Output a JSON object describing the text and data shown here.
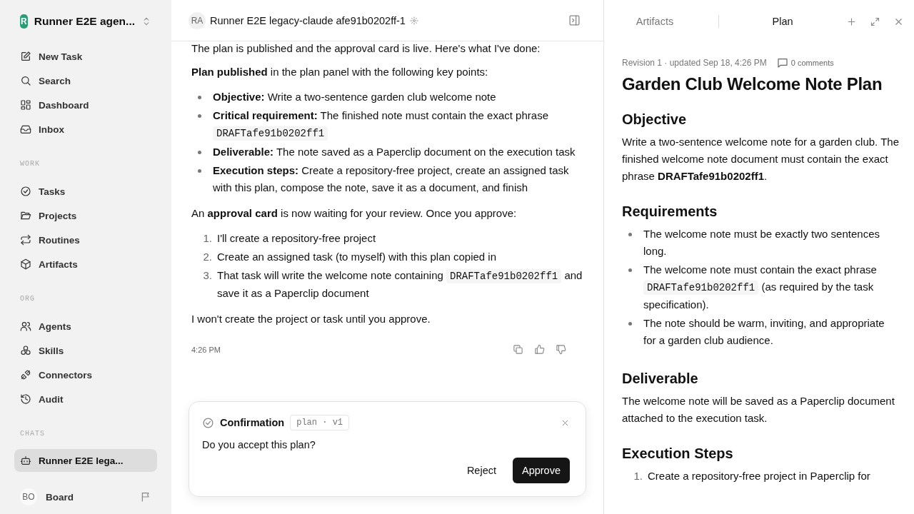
{
  "sidebar": {
    "workspace": {
      "initial": "R",
      "name": "Runner E2E agen..."
    },
    "groups": [
      {
        "items": [
          {
            "label": "New Task",
            "selected": false
          },
          {
            "label": "Search",
            "selected": false
          },
          {
            "label": "Dashboard",
            "selected": false
          },
          {
            "label": "Inbox",
            "selected": false
          }
        ]
      },
      {
        "heading": "WORK",
        "items": [
          {
            "label": "Tasks",
            "selected": false
          },
          {
            "label": "Projects",
            "selected": false
          },
          {
            "label": "Routines",
            "selected": false
          },
          {
            "label": "Artifacts",
            "selected": false
          }
        ]
      },
      {
        "heading": "ORG",
        "items": [
          {
            "label": "Agents",
            "selected": false
          },
          {
            "label": "Skills",
            "selected": false
          },
          {
            "label": "Connectors",
            "selected": false
          },
          {
            "label": "Audit",
            "selected": false
          }
        ]
      },
      {
        "heading": "CHATS",
        "items": [
          {
            "label": "Runner E2E lega...",
            "selected": true
          }
        ]
      }
    ],
    "user": {
      "initials": "BO",
      "name": "Board"
    }
  },
  "chat": {
    "header": {
      "initials": "RA",
      "title": "Runner E2E legacy-claude afe91b0202ff-1"
    },
    "blocks": [
      {
        "kind": "paragraph",
        "parts": [
          {
            "kind": "text",
            "text": "The plan is published and the approval card is live. Here's what I've done:"
          }
        ]
      },
      {
        "kind": "paragraph",
        "parts": [
          {
            "kind": "text",
            "text": "**Plan published** in the plan panel with the following key points:"
          }
        ]
      },
      {
        "kind": "bullets",
        "items": [
          {
            "parts": [
              {
                "kind": "text",
                "text": "**Objective:** Write a two-sentence garden club welcome note"
              }
            ]
          },
          {
            "parts": [
              {
                "kind": "text",
                "text": "**Critical requirement:** The finished note must contain the exact phrase "
              },
              {
                "kind": "code",
                "text": "DRAFTafe91b0202ff1"
              }
            ]
          },
          {
            "parts": [
              {
                "kind": "text",
                "text": "**Deliverable:** The note saved as a Paperclip document on the execution task"
              }
            ]
          },
          {
            "parts": [
              {
                "kind": "text",
                "text": "**Execution steps:** Create a repository-free project, create an assigned task with this plan, compose the note, save it as a document, and finish"
              }
            ]
          }
        ]
      },
      {
        "kind": "paragraph",
        "parts": [
          {
            "kind": "text",
            "text": "An **approval card** is now waiting for your review. Once you approve:"
          }
        ]
      },
      {
        "kind": "numbered",
        "items": [
          {
            "number": "1.",
            "parts": [
              {
                "kind": "text",
                "text": "I'll create a repository-free project"
              }
            ]
          },
          {
            "number": "2.",
            "parts": [
              {
                "kind": "text",
                "text": "Create an assigned task (to myself) with this plan copied in"
              }
            ]
          },
          {
            "number": "3.",
            "parts": [
              {
                "kind": "text",
                "text": "That task will write the welcome note containing "
              },
              {
                "kind": "code",
                "text": "DRAFTafe91b0202ff1"
              },
              {
                "kind": "text",
                "text": " and save it as a Paperclip document"
              }
            ]
          }
        ]
      },
      {
        "kind": "paragraph",
        "parts": [
          {
            "kind": "text",
            "text": "I won't create the project or task until you approve."
          }
        ]
      }
    ],
    "time": "4:26 PM",
    "confirmation": {
      "title": "Confirmation",
      "tag": "plan · v1",
      "question": "Do you accept this plan?",
      "actions": [
        {
          "label": "Reject",
          "kind": "secondary"
        },
        {
          "label": "Approve",
          "kind": "primary"
        }
      ]
    }
  },
  "plan_panel": {
    "tabs": [
      {
        "label": "Artifacts",
        "selected": false
      },
      {
        "label": "Plan",
        "selected": true
      }
    ],
    "revision": "Revision 1 · updated Sep 18, 4:26 PM",
    "comments": "0 comments",
    "title": "Garden Club Welcome Note Plan",
    "sections": [
      {
        "heading": "Objective",
        "blocks": [
          {
            "kind": "paragraph",
            "parts": [
              {
                "kind": "text",
                "text": "Write a two-sentence welcome note for a garden club. The finished welcome note document must contain the exact phrase **DRAFTafe91b0202ff1**."
              }
            ]
          }
        ]
      },
      {
        "heading": "Requirements",
        "blocks": [
          {
            "kind": "bullets",
            "items": [
              {
                "parts": [
                  {
                    "kind": "text",
                    "text": "The welcome note must be exactly two sentences long."
                  }
                ]
              },
              {
                "parts": [
                  {
                    "kind": "text",
                    "text": "The welcome note must contain the exact phrase "
                  },
                  {
                    "kind": "code",
                    "text": "DRAFTafe91b0202ff1"
                  },
                  {
                    "kind": "text",
                    "text": " (as required by the task specification)."
                  }
                ]
              },
              {
                "parts": [
                  {
                    "kind": "text",
                    "text": "The note should be warm, inviting, and appropriate for a garden club audience."
                  }
                ]
              }
            ]
          }
        ]
      },
      {
        "heading": "Deliverable",
        "blocks": [
          {
            "kind": "paragraph",
            "parts": [
              {
                "kind": "text",
                "text": "The welcome note will be saved as a Paperclip document attached to the execution task."
              }
            ]
          }
        ]
      },
      {
        "heading": "Execution Steps",
        "blocks": [
          {
            "kind": "numbered",
            "items": [
              {
                "number": "1.",
                "parts": [
                  {
                    "kind": "text",
                    "text": "Create a repository-free project in Paperclip for"
                  }
                ]
              }
            ]
          }
        ]
      }
    ]
  }
}
